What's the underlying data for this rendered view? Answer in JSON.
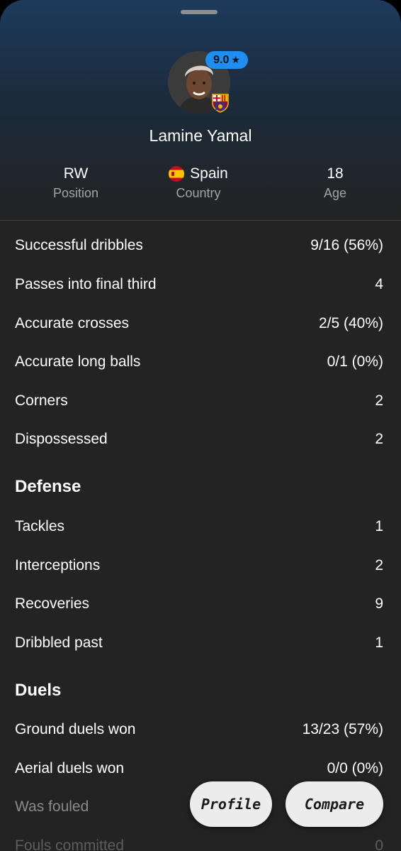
{
  "player": {
    "name": "Lamine Yamal",
    "rating": "9.0",
    "position_value": "RW",
    "position_label": "Position",
    "country_value": "Spain",
    "country_label": "Country",
    "age_value": "18",
    "age_label": "Age"
  },
  "stats": [
    {
      "label": "Successful dribbles",
      "value": "9/16 (56%)"
    },
    {
      "label": "Passes into final third",
      "value": "4"
    },
    {
      "label": "Accurate crosses",
      "value": "2/5 (40%)"
    },
    {
      "label": "Accurate long balls",
      "value": "0/1 (0%)"
    },
    {
      "label": "Corners",
      "value": "2"
    },
    {
      "label": "Dispossessed",
      "value": "2"
    }
  ],
  "defense": {
    "title": "Defense",
    "rows": [
      {
        "label": "Tackles",
        "value": "1"
      },
      {
        "label": "Interceptions",
        "value": "2"
      },
      {
        "label": "Recoveries",
        "value": "9"
      },
      {
        "label": "Dribbled past",
        "value": "1"
      }
    ]
  },
  "duels": {
    "title": "Duels",
    "rows": [
      {
        "label": "Ground duels won",
        "value": "13/23 (57%)"
      },
      {
        "label": "Aerial duels won",
        "value": "0/0 (0%)"
      },
      {
        "label": "Was fouled",
        "value": ""
      },
      {
        "label": "Fouls committed",
        "value": "0"
      }
    ]
  },
  "actions": {
    "profile": "Profile",
    "compare": "Compare"
  },
  "colors": {
    "accent": "#1f8ef1",
    "background": "#232323",
    "header_gradient_top": "#1d3a5c"
  }
}
